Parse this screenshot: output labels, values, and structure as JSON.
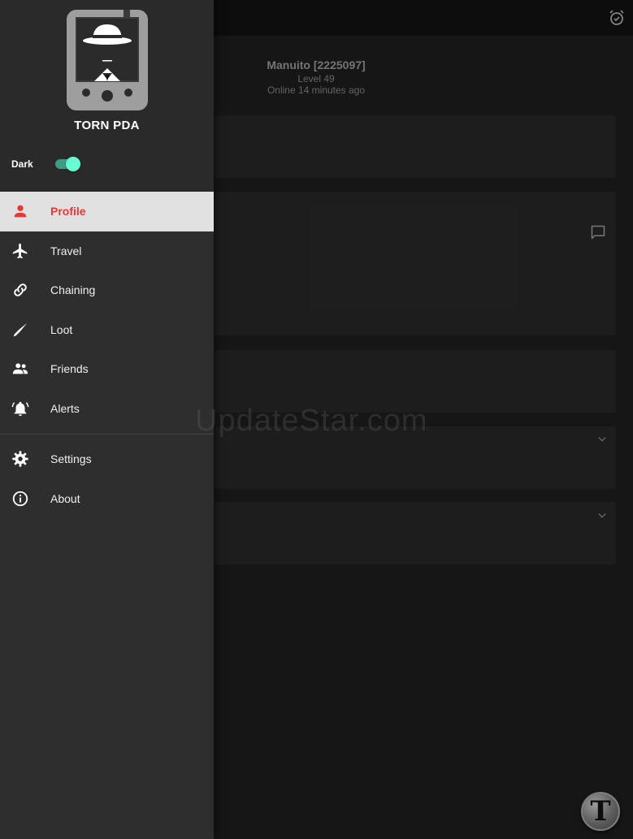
{
  "profile": {
    "name": "Manuito [2225097]",
    "level": "Level 49",
    "status": "Online 14 minutes ago"
  },
  "watermark": "UpdateStar.com",
  "fab": {
    "letter": "T"
  },
  "drawer": {
    "app_title": "TORN PDA",
    "theme_label": "Dark",
    "theme_toggle_on": true,
    "nav_items": [
      {
        "label": "Profile",
        "icon": "person-icon",
        "active": true
      },
      {
        "label": "Travel",
        "icon": "airplane-icon",
        "active": false
      },
      {
        "label": "Chaining",
        "icon": "link-icon",
        "active": false
      },
      {
        "label": "Loot",
        "icon": "knife-icon",
        "active": false
      },
      {
        "label": "Friends",
        "icon": "people-icon",
        "active": false
      },
      {
        "label": "Alerts",
        "icon": "bell-icon",
        "active": false
      }
    ],
    "secondary_items": [
      {
        "label": "Settings",
        "icon": "gear-icon"
      },
      {
        "label": "About",
        "icon": "info-icon"
      }
    ]
  },
  "colors": {
    "accent_active": "#e53935",
    "toggle_on": "#66ffd4",
    "drawer_bg": "#2e2e2e",
    "page_bg": "#1a1a1a"
  }
}
